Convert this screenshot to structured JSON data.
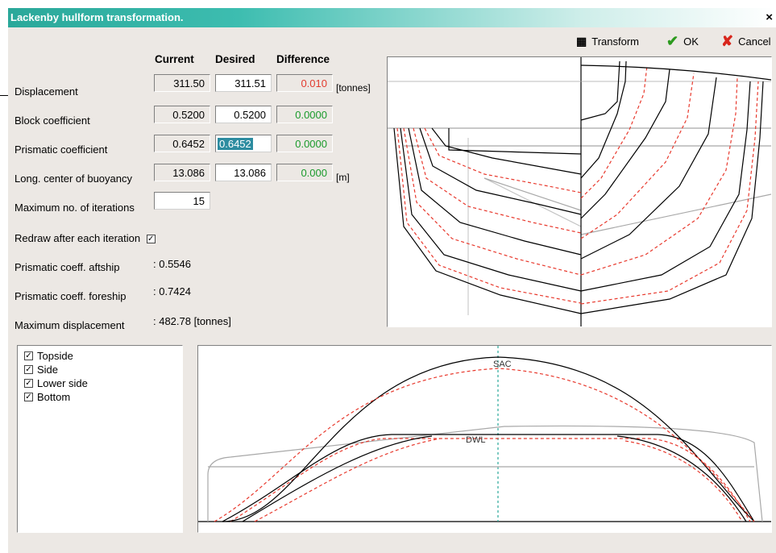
{
  "window": {
    "title": "Lackenby hullform transformation.",
    "close": "×"
  },
  "toolbar": {
    "transform": "Transform",
    "ok": "OK",
    "cancel": "Cancel"
  },
  "columns": {
    "current": "Current",
    "desired": "Desired",
    "difference": "Difference"
  },
  "rows": {
    "displacement": {
      "label": "Displacement",
      "current": "311.50",
      "desired": "311.51",
      "difference": "0.010",
      "unit": "[tonnes]"
    },
    "block": {
      "label": "Block coefficient",
      "current": "0.5200",
      "desired": "0.5200",
      "difference": "0.0000"
    },
    "prismatic": {
      "label": "Prismatic coefficient",
      "current": "0.6452",
      "desired": "0.6452",
      "difference": "0.0000"
    },
    "lcb": {
      "label": "Long. center of buoyancy",
      "current": "13.086",
      "desired": "13.086",
      "difference": "0.000",
      "unit": "[m]"
    }
  },
  "iterations": {
    "label": "Maximum no. of iterations",
    "value": "15"
  },
  "redraw": {
    "label": "Redraw after each iteration",
    "checked": true
  },
  "info": {
    "aft": {
      "label": "Prismatic coeff. aftship",
      "value": ": 0.5546"
    },
    "fore": {
      "label": "Prismatic coeff. foreship",
      "value": ": 0.7424"
    },
    "maxdisp": {
      "label": "Maximum displacement",
      "value": ": 482.78 [tonnes]"
    }
  },
  "layers": [
    {
      "label": "Topside",
      "checked": true
    },
    {
      "label": "Side",
      "checked": true
    },
    {
      "label": "Lower side",
      "checked": true
    },
    {
      "label": "Bottom",
      "checked": true
    }
  ],
  "curves": {
    "sac": "SAC",
    "dwl": "DWL"
  },
  "colors": {
    "current_line": "#000000",
    "desired_line": "#e8392d",
    "grid": "#a8a8a8",
    "titlebar": "#2aa89a"
  }
}
